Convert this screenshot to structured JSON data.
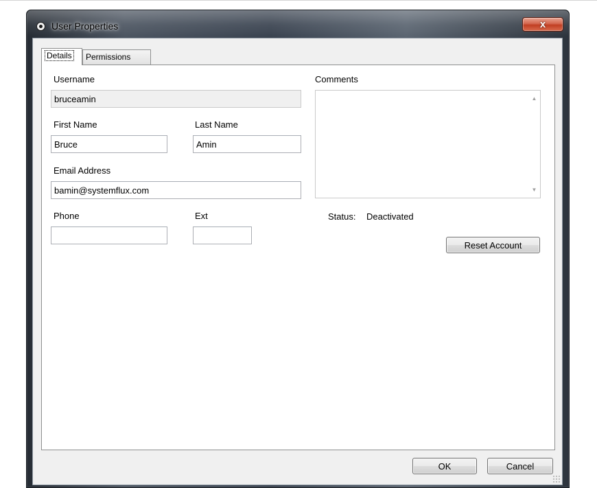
{
  "window": {
    "title": "User Properties",
    "close_label": "x"
  },
  "tabs": [
    {
      "label": "Details",
      "active": true
    },
    {
      "label": "Permissions",
      "active": false
    }
  ],
  "form": {
    "username": {
      "label": "Username",
      "value": "bruceamin",
      "readonly": true
    },
    "first_name": {
      "label": "First Name",
      "value": "Bruce"
    },
    "last_name": {
      "label": "Last Name",
      "value": "Amin"
    },
    "email": {
      "label": "Email Address",
      "value": "bamin@systemflux.com"
    },
    "phone": {
      "label": "Phone",
      "value": ""
    },
    "ext": {
      "label": "Ext",
      "value": ""
    },
    "comments": {
      "label": "Comments",
      "value": ""
    }
  },
  "status": {
    "label": "Status:",
    "value": "Deactivated"
  },
  "buttons": {
    "reset_account": "Reset Account",
    "ok": "OK",
    "cancel": "Cancel"
  },
  "icons": {
    "app": "app-circle-icon",
    "close": "close-icon",
    "scroll_up": "scroll-up-arrow-icon",
    "scroll_down": "scroll-down-arrow-icon",
    "resize": "resize-grip-icon"
  }
}
